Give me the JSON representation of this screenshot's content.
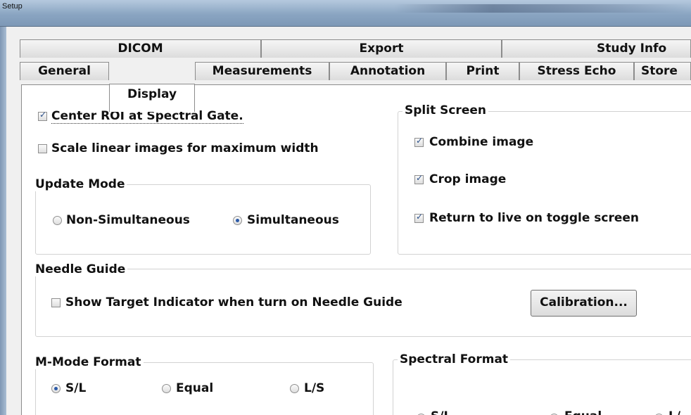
{
  "window": {
    "title": "Setup"
  },
  "tabs_back": [
    "DICOM",
    "Export",
    "Study Info"
  ],
  "tabs_front": [
    "General",
    "Display",
    "Measurements",
    "Annotation",
    "Print",
    "Stress Echo",
    "Store"
  ],
  "active_tab": "Display",
  "display": {
    "center_roi": {
      "label": "Center ROI at Spectral Gate.",
      "checked": true
    },
    "scale_linear": {
      "label": "Scale linear images for maximum width",
      "checked": false
    },
    "update_mode": {
      "title": "Update Mode",
      "options": [
        "Non-Simultaneous",
        "Simultaneous"
      ],
      "selected": "Simultaneous"
    },
    "split_screen": {
      "title": "Split Screen",
      "options": [
        {
          "label": "Combine image",
          "checked": true
        },
        {
          "label": "Crop image",
          "checked": true
        },
        {
          "label": "Return to live on toggle screen",
          "checked": true
        }
      ]
    },
    "needle_guide": {
      "title": "Needle Guide",
      "show_target": {
        "label": "Show Target Indicator when turn on Needle Guide",
        "checked": false
      },
      "calibration_button": "Calibration..."
    },
    "mmode_format": {
      "title": "M-Mode Format",
      "options": [
        "S/L",
        "Equal",
        "L/S"
      ],
      "selected": "S/L"
    },
    "spectral_format": {
      "title": "Spectral Format",
      "options": [
        "S/L",
        "Equal",
        "L/"
      ],
      "selected": "Equal"
    }
  }
}
